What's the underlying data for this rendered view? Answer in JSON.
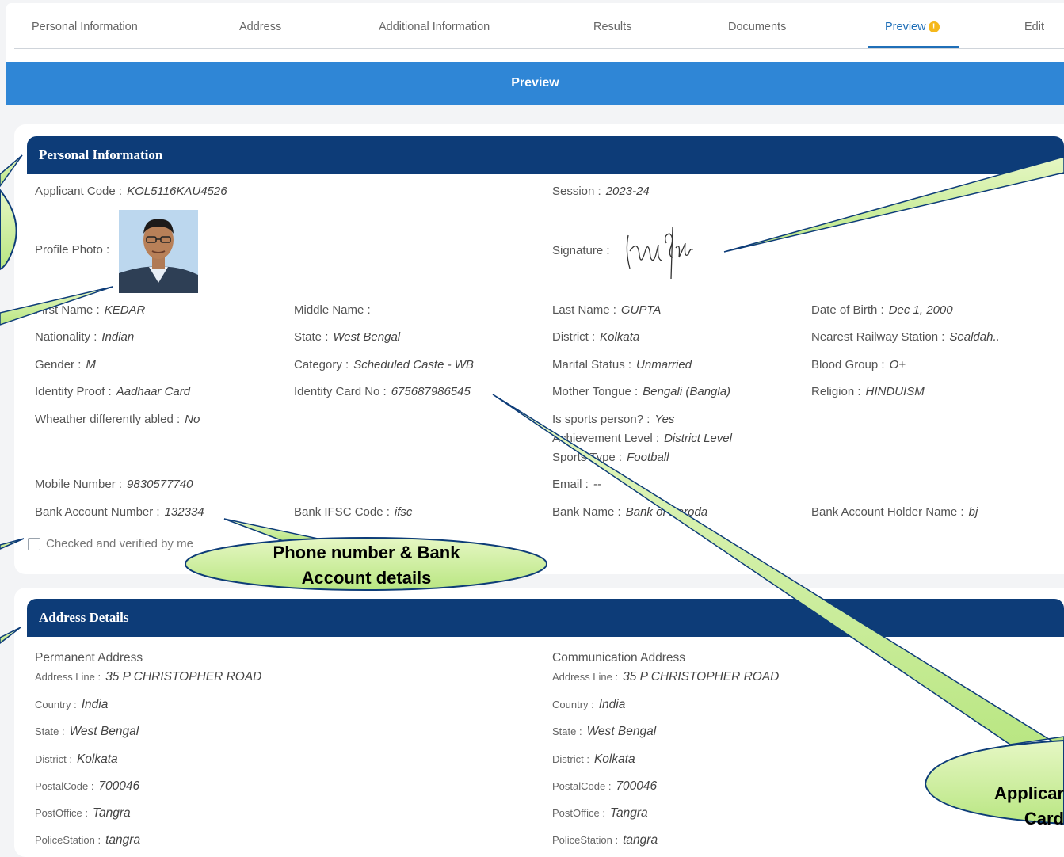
{
  "tabs": [
    {
      "label": "Personal Information"
    },
    {
      "label": "Address"
    },
    {
      "label": "Additional Information"
    },
    {
      "label": "Results"
    },
    {
      "label": "Documents"
    },
    {
      "label": "Preview",
      "badge": "!"
    },
    {
      "label": "Edit"
    }
  ],
  "banner": {
    "title": "Preview"
  },
  "personal": {
    "heading": "Personal Information",
    "applicant_code": {
      "label": "Applicant Code :",
      "value": "KOL5116KAU4526"
    },
    "session": {
      "label": "Session :",
      "value": "2023-24"
    },
    "profile_photo": {
      "label": "Profile Photo :"
    },
    "signature": {
      "label": "Signature :"
    },
    "first_name": {
      "label": "First Name :",
      "value": "KEDAR"
    },
    "middle_name": {
      "label": "Middle Name :",
      "value": ""
    },
    "last_name": {
      "label": "Last Name :",
      "value": "GUPTA"
    },
    "dob": {
      "label": "Date of Birth :",
      "value": "Dec 1, 2000"
    },
    "nationality": {
      "label": "Nationality :",
      "value": "Indian"
    },
    "state": {
      "label": "State :",
      "value": "West Bengal"
    },
    "district": {
      "label": "District :",
      "value": "Kolkata"
    },
    "railway": {
      "label": "Nearest Railway Station :",
      "value": "Sealdah.."
    },
    "gender": {
      "label": "Gender :",
      "value": "M"
    },
    "category": {
      "label": "Category :",
      "value": "Scheduled Caste - WB"
    },
    "marital": {
      "label": "Marital Status :",
      "value": "Unmarried"
    },
    "blood": {
      "label": "Blood Group :",
      "value": "O+"
    },
    "id_proof": {
      "label": "Identity Proof :",
      "value": "Aadhaar Card"
    },
    "id_card_no": {
      "label": "Identity Card No :",
      "value": "675687986545"
    },
    "mother_tongue": {
      "label": "Mother Tongue :",
      "value": "Bengali (Bangla)"
    },
    "religion": {
      "label": "Religion :",
      "value": "HINDUISM"
    },
    "differently_abled": {
      "label": "Wheather differently abled :",
      "value": "No"
    },
    "sports_person": {
      "label": "Is sports person? :",
      "value": "Yes"
    },
    "achievement": {
      "label": "Achievement Level :",
      "value": "District Level"
    },
    "sports_type": {
      "label": "Sports Type :",
      "value": "Football"
    },
    "mobile": {
      "label": "Mobile Number :",
      "value": "9830577740"
    },
    "email": {
      "label": "Email :",
      "value": "--"
    },
    "bank_account": {
      "label": "Bank Account Number :",
      "value": "132334"
    },
    "ifsc": {
      "label": "Bank IFSC Code :",
      "value": "ifsc"
    },
    "bank_name": {
      "label": "Bank Name :",
      "value": "Bank of Baroda"
    },
    "holder": {
      "label": "Bank Account Holder Name :",
      "value": "bj"
    },
    "verify_label": "Checked and verified by me"
  },
  "address": {
    "heading": "Address Details",
    "permanent": {
      "title": "Permanent Address",
      "line": {
        "label": "Address Line :",
        "value": "35 P CHRISTOPHER ROAD"
      },
      "country": {
        "label": "Country :",
        "value": "India"
      },
      "state": {
        "label": "State :",
        "value": "West Bengal"
      },
      "district": {
        "label": "District :",
        "value": "Kolkata"
      },
      "postal": {
        "label": "PostalCode :",
        "value": "700046"
      },
      "postoffice": {
        "label": "PostOffice :",
        "value": "Tangra"
      },
      "police": {
        "label": "PoliceStation :",
        "value": "tangra"
      }
    },
    "communication": {
      "title": "Communication Address",
      "line": {
        "label": "Address Line :",
        "value": "35 P CHRISTOPHER ROAD"
      },
      "country": {
        "label": "Country :",
        "value": "India"
      },
      "state": {
        "label": "State :",
        "value": "West Bengal"
      },
      "district": {
        "label": "District :",
        "value": "Kolkata"
      },
      "postal": {
        "label": "PostalCode :",
        "value": "700046"
      },
      "postoffice": {
        "label": "PostOffice :",
        "value": "Tangra"
      },
      "police": {
        "label": "PoliceStation :",
        "value": "tangra"
      }
    }
  },
  "callouts": {
    "bank": {
      "line1": "Phone number & Bank",
      "line2": "Account details"
    },
    "id_card": {
      "line1": "Applicar",
      "line2": "Card"
    }
  },
  "colors": {
    "accent": "#2f86d6",
    "header": "#0d3c78",
    "callout": "#c9ee9d",
    "badge": "#f5b81c"
  }
}
